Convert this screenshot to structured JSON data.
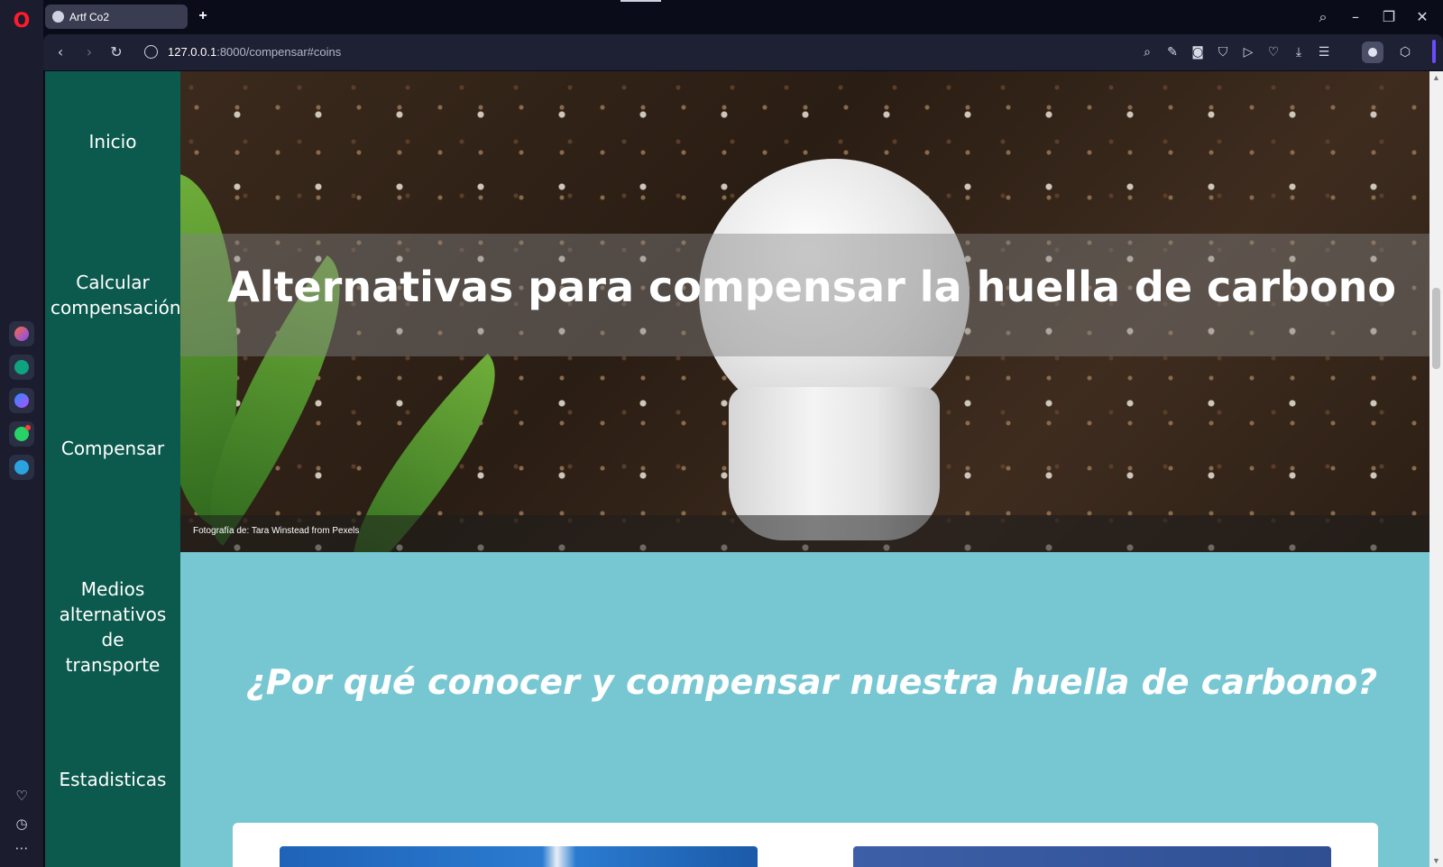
{
  "browser": {
    "tab_title": "Artf Co2",
    "url_host": "127.0.0.1",
    "url_path": ":8000/compensar#coins"
  },
  "sidebar_apps": [
    "aria-icon",
    "chatgpt-icon",
    "messenger-icon",
    "whatsapp-icon",
    "telegram-icon"
  ],
  "nav": {
    "items": [
      {
        "label": "Inicio"
      },
      {
        "label": "Calcular compensación"
      },
      {
        "label": "Compensar"
      },
      {
        "label": "Medios alternativos de transporte"
      },
      {
        "label": "Estadisticas"
      }
    ]
  },
  "hero": {
    "title": "Alternativas para compensar la huella de carbono",
    "credit": "Fotografía de: Tara Winstead from Pexels"
  },
  "section": {
    "question": "¿Por qué conocer y compensar nuestra huella de carbono?"
  },
  "colors": {
    "nav_bg": "#0c5a4d",
    "section_bg": "#77c7d3",
    "browser_bg": "#0b0c1a"
  }
}
